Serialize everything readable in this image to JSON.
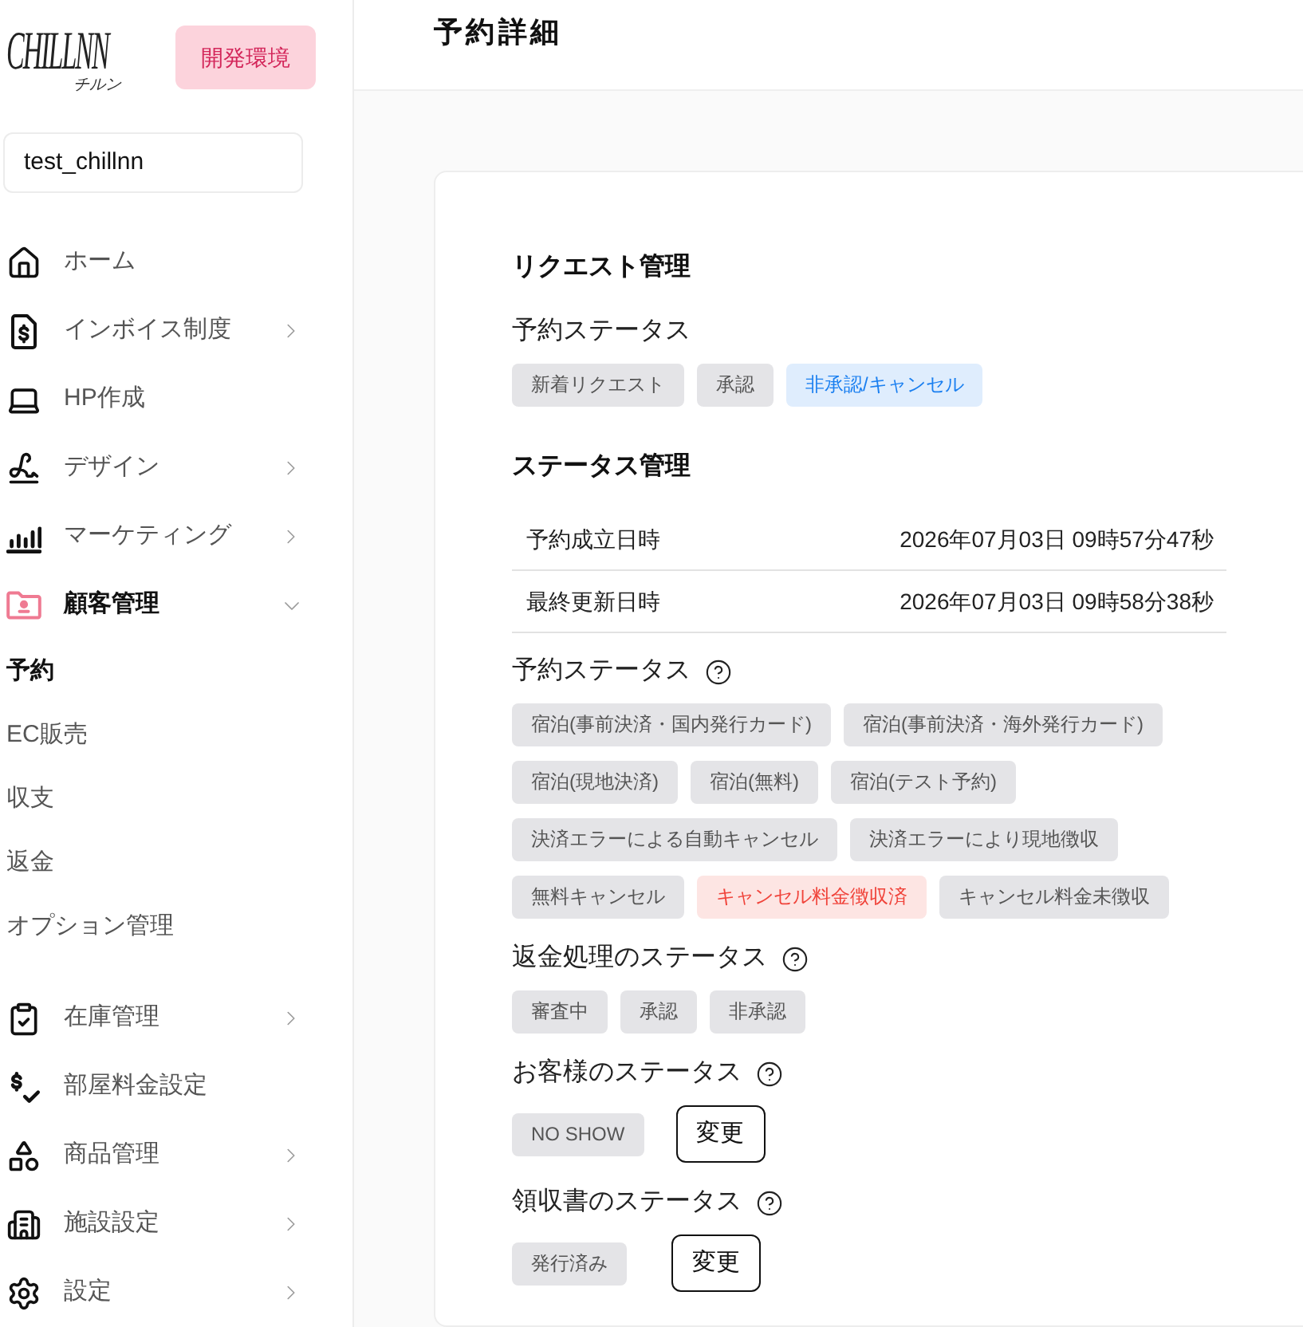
{
  "sidebar": {
    "logo": {
      "wordmark": "CHILLNN",
      "kana": "チルン"
    },
    "env_badge": "開発環境",
    "account": "test_chillnn",
    "nav": [
      {
        "label": "ホーム",
        "active": false,
        "submenu": false
      },
      {
        "label": "インボイス制度",
        "active": false,
        "submenu": true,
        "expanded": false
      },
      {
        "label": "HP作成",
        "active": false,
        "submenu": false
      },
      {
        "label": "デザイン",
        "active": false,
        "submenu": true,
        "expanded": false
      },
      {
        "label": "マーケティング",
        "active": false,
        "submenu": true,
        "expanded": false
      },
      {
        "label": "顧客管理",
        "active": true,
        "submenu": true,
        "expanded": true,
        "children": [
          {
            "label": "予約",
            "selected": true
          },
          {
            "label": "EC販売",
            "selected": false
          },
          {
            "label": "収支",
            "selected": false
          },
          {
            "label": "返金",
            "selected": false
          },
          {
            "label": "オプション管理",
            "selected": false
          }
        ]
      },
      {
        "label": "在庫管理",
        "active": false,
        "submenu": true,
        "expanded": false
      },
      {
        "label": "部屋料金設定",
        "active": false,
        "submenu": false
      },
      {
        "label": "商品管理",
        "active": false,
        "submenu": true,
        "expanded": false
      },
      {
        "label": "施設設定",
        "active": false,
        "submenu": true,
        "expanded": false
      },
      {
        "label": "設定",
        "active": false,
        "submenu": true,
        "expanded": false
      }
    ]
  },
  "header": {
    "title": "予約詳細"
  },
  "card": {
    "sections": [
      {
        "kind": "heading",
        "text": "リクエスト管理"
      },
      {
        "kind": "status",
        "label": "予約ステータス",
        "help": false,
        "chips": [
          {
            "label": "新着リクエスト",
            "selected": false
          },
          {
            "label": "承認",
            "selected": false
          },
          {
            "label": "非承認/キャンセル",
            "selected": true,
            "color": "#1a7ff0"
          }
        ]
      },
      {
        "kind": "heading",
        "text": "ステータス管理"
      },
      {
        "kind": "table",
        "rows": [
          {
            "label": "予約成立日時",
            "value": "2026年07月03日 09時57分47秒"
          },
          {
            "label": "最終更新日時",
            "value": "2026年07月03日 09時58分38秒"
          }
        ]
      },
      {
        "kind": "status",
        "label": "予約ステータス",
        "help": true,
        "chips": [
          {
            "label": "宿泊(事前決済・国内発行カード)",
            "selected": false
          },
          {
            "label": "宿泊(事前決済・海外発行カード)",
            "selected": false
          },
          {
            "label": "宿泊(現地決済)",
            "selected": false
          },
          {
            "label": "宿泊(無料)",
            "selected": false
          },
          {
            "label": "宿泊(テスト予約)",
            "selected": false
          },
          {
            "label": "決済エラーによる自動キャンセル",
            "selected": false
          },
          {
            "label": "決済エラーにより現地徴収",
            "selected": false
          },
          {
            "label": "無料キャンセル",
            "selected": false
          },
          {
            "label": "キャンセル料金徴収済",
            "selected": true,
            "color": "#f0433a"
          },
          {
            "label": "キャンセル料金未徴収",
            "selected": false
          }
        ]
      },
      {
        "kind": "status",
        "label": "返金処理のステータス",
        "help": true,
        "chips": [
          {
            "label": "審査中",
            "selected": false
          },
          {
            "label": "承認",
            "selected": false
          },
          {
            "label": "非承認",
            "selected": false
          }
        ]
      },
      {
        "kind": "status",
        "label": "お客様のステータス",
        "help": true,
        "chips": [
          {
            "label": "NO SHOW",
            "selected": false
          }
        ],
        "action": "変更"
      },
      {
        "kind": "status",
        "label": "領収書のステータス",
        "help": true,
        "chips": [
          {
            "label": "発行済み",
            "selected": false
          }
        ],
        "action": "変更"
      }
    ]
  }
}
